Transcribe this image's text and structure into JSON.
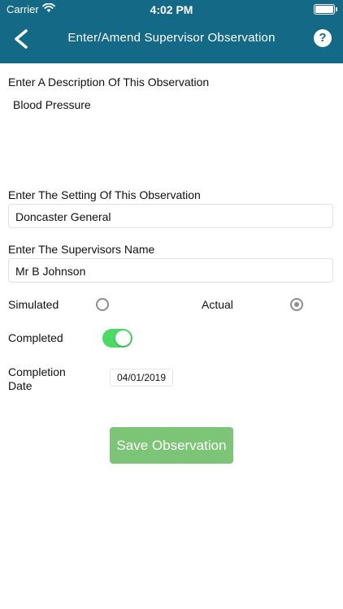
{
  "status_bar": {
    "carrier": "Carrier",
    "time": "4:02 PM"
  },
  "header": {
    "title": "Enter/Amend Supervisor Observation",
    "help_label": "?"
  },
  "form": {
    "description_label": "Enter A Description Of This Observation",
    "description_value": "Blood Pressure",
    "setting_label": "Enter The Setting Of This Observation",
    "setting_value": "Doncaster General",
    "supervisor_label": "Enter The Supervisors Name",
    "supervisor_value": "Mr B Johnson",
    "simulated_label": "Simulated",
    "actual_label": "Actual",
    "selected_type": "Actual",
    "completed_label": "Completed",
    "completed": true,
    "completion_date_label_line1": "Completion",
    "completion_date_label_line2": "Date",
    "completion_date": "04/01/2019",
    "save_label": "Save Observation"
  },
  "colors": {
    "header_bg": "#146a86",
    "save_button": "#7cc576",
    "toggle_on": "#4cd964"
  }
}
